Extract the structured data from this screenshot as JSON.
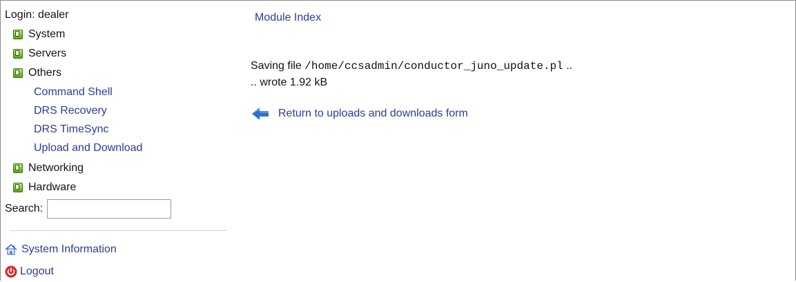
{
  "sidebar": {
    "login_text": "Login: dealer",
    "categories": [
      {
        "label": "System"
      },
      {
        "label": "Servers"
      },
      {
        "label": "Others"
      },
      {
        "label": "Networking"
      },
      {
        "label": "Hardware"
      }
    ],
    "others_items": [
      {
        "label": "Command Shell"
      },
      {
        "label": "DRS Recovery"
      },
      {
        "label": "DRS TimeSync"
      },
      {
        "label": "Upload and Download"
      }
    ],
    "search_label": "Search:",
    "search_value": "",
    "system_information": "System Information",
    "logout": "Logout"
  },
  "main": {
    "module_index": "Module Index",
    "saving_prefix": "Saving file",
    "saving_path": "/home/ccsadmin/conductor_juno_update.pl",
    "saving_suffix": "..",
    "wrote_text": ".. wrote 1.92 kB",
    "return_link": "Return to uploads and downloads form"
  },
  "colors": {
    "link": "#2b3b9a",
    "text": "#111111",
    "category_box": "#5aa717",
    "border": "#8a8a8a"
  },
  "icons": {
    "category": "expand-box-icon",
    "system_information": "home-icon",
    "logout": "power-icon",
    "return": "back-arrow-icon"
  }
}
